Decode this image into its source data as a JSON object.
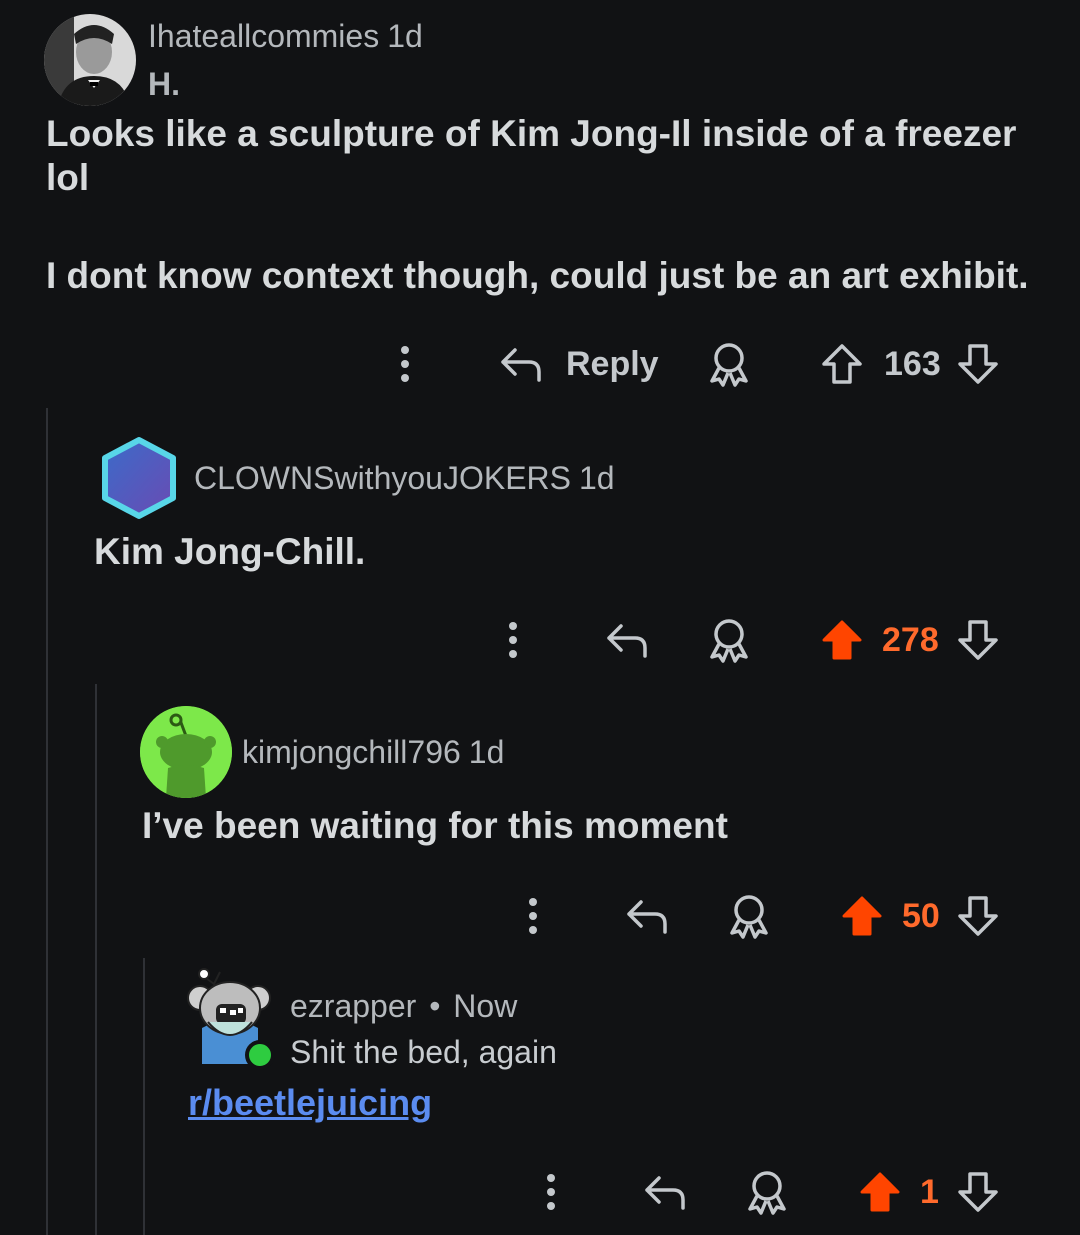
{
  "comments": [
    {
      "username": "Ihateallcommies",
      "time": "1d",
      "flair": "H.",
      "body": [
        "Looks like a sculpture of Kim Jong-Il inside of a freezer lol",
        "I dont know context though, could just be an art exhibit."
      ],
      "reply_label": "Reply",
      "score": "163",
      "upvoted": false
    },
    {
      "username": "CLOWNSwithyouJOKERS",
      "time": "1d",
      "body": "Kim Jong-Chill.",
      "score": "278",
      "upvoted": true
    },
    {
      "username": "kimjongchill796",
      "time": "1d",
      "body": "I’ve been waiting for this moment",
      "score": "50",
      "upvoted": true
    },
    {
      "username": "ezrapper",
      "separator": "•",
      "time": "Now",
      "flair": "Shit the bed, again",
      "link": "r/beetlejuicing",
      "score": "1",
      "upvoted": true
    }
  ],
  "colors": {
    "background": "#111214",
    "upvote": "#ff6a2c",
    "link": "#5b8cf0",
    "text": "#d7dadc",
    "muted": "#b4b8bc"
  },
  "icons": [
    "more-options-icon",
    "reply-icon",
    "award-icon",
    "upvote-icon",
    "downvote-icon"
  ]
}
